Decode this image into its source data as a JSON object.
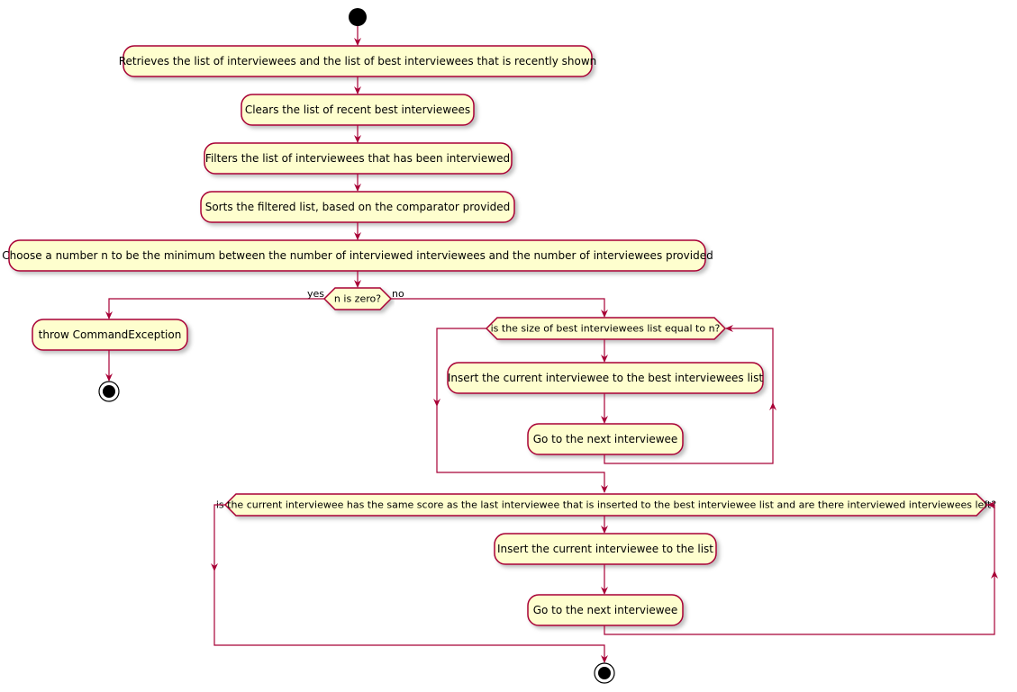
{
  "colors": {
    "node_fill": "#FEFECE",
    "node_border": "#A80036",
    "start_stop": "#000000"
  },
  "nodes": {
    "retrieve": "Retrieves the list of interviewees and the list of best interviewees that is recently shown",
    "clear": "Clears the list of recent best interviewees",
    "filter": "Filters the list of interviewees that has been interviewed",
    "sort": "Sorts the filtered list, based on the comparator provided",
    "choose_n": "Choose a number n to be the minimum between the number of interviewed interviewees and the number of interviewees provided",
    "decision_zero": "n is zero?",
    "yes_label": "yes",
    "no_label": "no",
    "throw": "throw CommandException",
    "loop1_condition": "is the size of best interviewees list equal to n?",
    "insert_best": "Insert the current interviewee to the best interviewees list",
    "next1": "Go to the next interviewee",
    "loop2_condition": "is the current interviewee has the same score as the last interviewee that is inserted to the best interviewee list and are there interviewed interviewees left?",
    "insert_list": "Insert the current interviewee to the list",
    "next2": "Go to the next interviewee"
  }
}
